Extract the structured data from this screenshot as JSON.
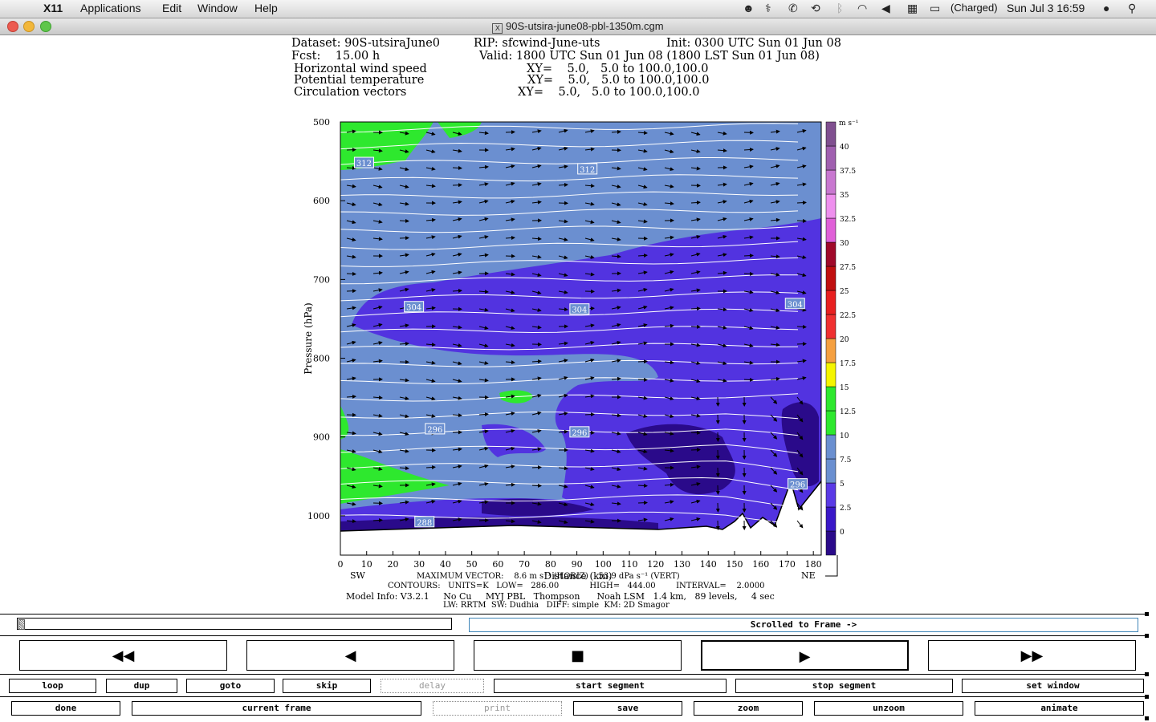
{
  "menubar": {
    "app_name": "X11",
    "items": [
      "Applications",
      "Edit",
      "Window",
      "Help"
    ],
    "battery": "(Charged)",
    "clock": "Sun Jul 3  16:59"
  },
  "window": {
    "title": "90S-utsira-june08-pbl-1350m.cgm"
  },
  "header": {
    "line1_left": "Dataset: 90S-utsiraJune0",
    "line1_mid": "RIP: sfcwind-June-uts",
    "line1_right": "Init: 0300 UTC Sun 01 Jun 08",
    "line2_left": "Fcst:    15.00 h",
    "line2_right": "Valid: 1800 UTC Sun 01 Jun 08 (1800 LST Sun 01 Jun 08)",
    "field1": "Horizontal wind speed",
    "field1_xy": "XY=    5.0,   5.0 to 100.0,100.0",
    "field2": "Potential temperature",
    "field2_xy": "XY=    5.0,   5.0 to 100.0,100.0",
    "field3": "Circulation vectors",
    "field3_xy": "XY=    5.0,   5.0 to 100.0,100.0"
  },
  "chart_data": {
    "type": "heatmap",
    "xlabel": "Distance (km)",
    "ylabel": "Pressure (hPa)",
    "x_ticks": [
      0,
      10,
      20,
      30,
      40,
      50,
      60,
      70,
      80,
      90,
      100,
      110,
      120,
      130,
      140,
      150,
      160,
      170,
      180
    ],
    "y_ticks": [
      500,
      600,
      700,
      800,
      900,
      1000
    ],
    "xlim": [
      0,
      183
    ],
    "ylim": [
      500,
      1050
    ],
    "y_inverted": true,
    "left_end_label": "SW",
    "right_end_label": "NE",
    "contour_labels": [
      {
        "text": "312",
        "x": 9,
        "p": 552
      },
      {
        "text": "312",
        "x": 94,
        "p": 560
      },
      {
        "text": "304",
        "x": 28,
        "p": 735
      },
      {
        "text": "304",
        "x": 91,
        "p": 738
      },
      {
        "text": "304",
        "x": 173,
        "p": 731
      },
      {
        "text": "296",
        "x": 36,
        "p": 890
      },
      {
        "text": "296",
        "x": 91,
        "p": 894
      },
      {
        "text": "296",
        "x": 174,
        "p": 960
      },
      {
        "text": "288",
        "x": 32,
        "p": 1008
      }
    ],
    "colorbar": {
      "unit": "m s⁻¹",
      "levels": [
        0,
        2.5,
        5,
        7.5,
        10,
        12.5,
        15,
        17.5,
        20,
        22.5,
        25,
        27.5,
        30,
        32.5,
        35,
        37.5,
        40
      ],
      "level_labels": [
        "0",
        "2.5",
        "5",
        "7.5",
        "10",
        "12.5",
        "15",
        "17.5",
        "20",
        "22.5",
        "25",
        "27.5",
        "30",
        "32.5",
        "35",
        "37.5",
        "40"
      ],
      "colors": [
        "#2a0a8a",
        "#3a18c8",
        "#5a3ae6",
        "#6a8fd0",
        "#6a8fd0",
        "#2ee82e",
        "#2ee82e",
        "#f5f500",
        "#f5a040",
        "#f03030",
        "#e82020",
        "#c01010",
        "#a00a2a",
        "#e060d8",
        "#ee90ee",
        "#c878d0",
        "#a060b0",
        "#805090"
      ]
    },
    "footer": {
      "max_vector": "MAXIMUM VECTOR:    8.6 m s⁻¹ (HORIZ)    53.9 dPa s⁻¹ (VERT)",
      "contours": "CONTOURS:   UNITS=K   LOW=   286.00            HIGH=   444.00        INTERVAL=    2.0000",
      "model_info": "Model Info: V3.2.1     No Cu     MYJ PBL   Thompson      Noah LSM   1.4 km,   89 levels,     4 sec",
      "model_info2": "LW: RRTM  SW: Dudhia   DIFF: simple  KM: 2D Smagor"
    }
  },
  "controls": {
    "scroll_label": "Scrolled to Frame ->",
    "playback": [
      {
        "name": "rewind",
        "glyph": "◀◀"
      },
      {
        "name": "step-back",
        "glyph": "◀"
      },
      {
        "name": "stop",
        "glyph": "■"
      },
      {
        "name": "play",
        "glyph": "▶"
      },
      {
        "name": "fast-forward",
        "glyph": "▶▶"
      }
    ],
    "row1": [
      "loop",
      "dup",
      "goto",
      "skip",
      "delay",
      "start segment",
      "stop segment",
      "set window"
    ],
    "row2": [
      "done",
      "current frame",
      "print",
      "save",
      "zoom",
      "unzoom",
      "animate"
    ]
  }
}
